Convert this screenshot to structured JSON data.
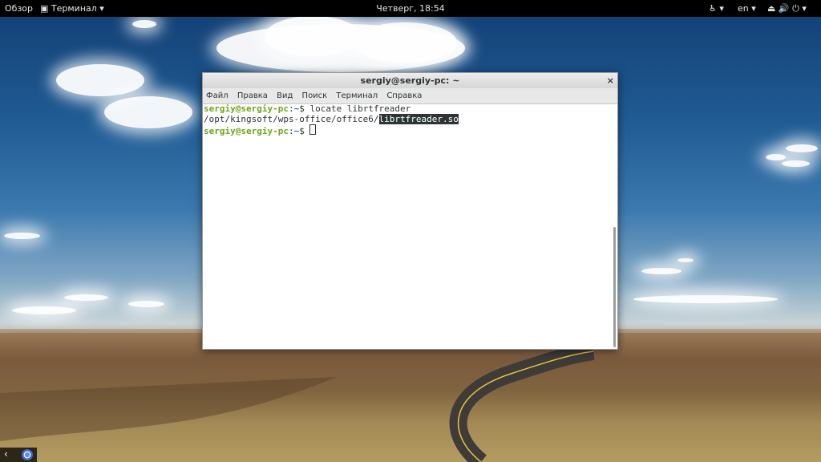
{
  "topbar": {
    "overview": "Обзор",
    "app_menu": "Терминал",
    "clock": "Четверг, 18:54",
    "language": "en"
  },
  "terminal": {
    "title": "sergiy@sergiy-pc: ~",
    "close": "×",
    "menu": [
      "Файл",
      "Правка",
      "Вид",
      "Поиск",
      "Терминал",
      "Справка"
    ],
    "lines": [
      {
        "user": "sergiy@sergiy-pc",
        "sep": ":",
        "path": "~",
        "prompt_end": "$ ",
        "command": "locate librtfreader"
      },
      {
        "output_prefix": "/opt/kingsoft/wps-office/office6/",
        "output_highlight": "librtfreader.so"
      },
      {
        "user": "sergiy@sergiy-pc",
        "sep": ":",
        "path": "~",
        "prompt_end": "$ "
      }
    ]
  },
  "icons": {
    "overview": "overview-icon",
    "terminal_app": "terminal-app-icon",
    "accessibility": "accessibility-icon",
    "network": "network-icon",
    "volume": "volume-icon",
    "power": "power-icon",
    "dock_arrow": "chevron-left-icon",
    "browser": "chrome-icon"
  }
}
